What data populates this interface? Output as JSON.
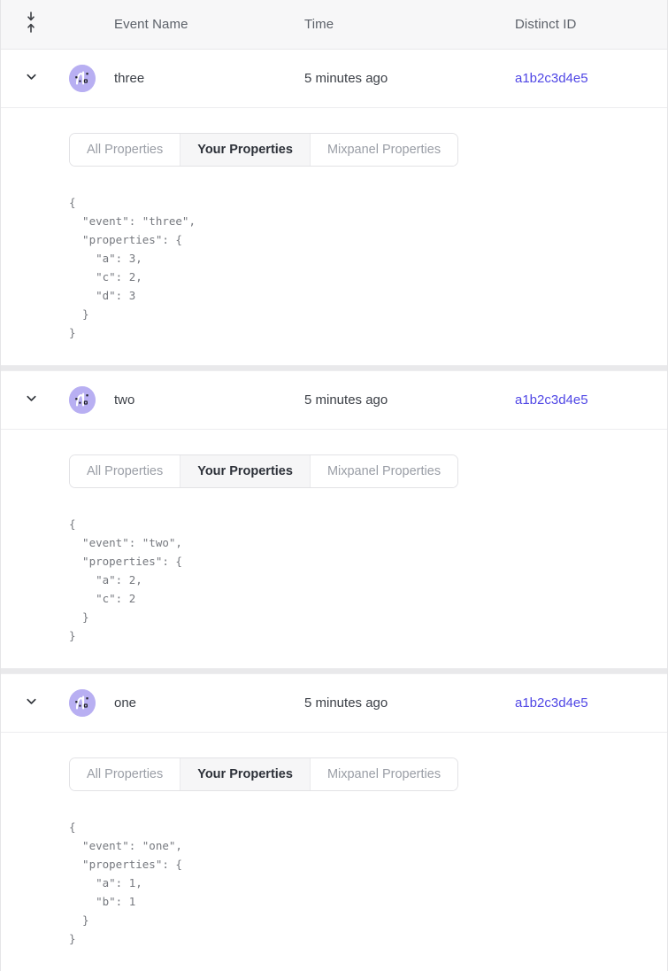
{
  "header": {
    "sort_icon": "sort-arrows-icon",
    "columns": [
      {
        "key": "event_name",
        "label": "Event Name"
      },
      {
        "key": "time",
        "label": "Time"
      },
      {
        "key": "distinct_id",
        "label": "Distinct ID"
      }
    ]
  },
  "tabs": {
    "all": "All Properties",
    "yours": "Your Properties",
    "mixpanel": "Mixpanel Properties",
    "active": "Your Properties"
  },
  "events": [
    {
      "expand_icon": "chevron-down-icon",
      "avatar_icon": "mixpanel-event-avatar-icon",
      "name": "three",
      "time": "5 minutes ago",
      "distinct_id": "a1b2c3d4e5",
      "expanded": true,
      "json": "{\n  \"event\": \"three\",\n  \"properties\": {\n    \"a\": 3,\n    \"c\": 2,\n    \"d\": 3\n  }\n}"
    },
    {
      "expand_icon": "chevron-down-icon",
      "avatar_icon": "mixpanel-event-avatar-icon",
      "name": "two",
      "time": "5 minutes ago",
      "distinct_id": "a1b2c3d4e5",
      "expanded": true,
      "json": "{\n  \"event\": \"two\",\n  \"properties\": {\n    \"a\": 2,\n    \"c\": 2\n  }\n}"
    },
    {
      "expand_icon": "chevron-down-icon",
      "avatar_icon": "mixpanel-event-avatar-icon",
      "name": "one",
      "time": "5 minutes ago",
      "distinct_id": "a1b2c3d4e5",
      "expanded": true,
      "json": "{\n  \"event\": \"one\",\n  \"properties\": {\n    \"a\": 1,\n    \"b\": 1\n  }\n}"
    }
  ],
  "colors": {
    "link": "#4f46e5",
    "avatar_bg": "#b8aff2",
    "header_bg": "#f7f7f8",
    "active_tab_bg": "#f6f6f7",
    "separator": "#e9e9eb"
  }
}
